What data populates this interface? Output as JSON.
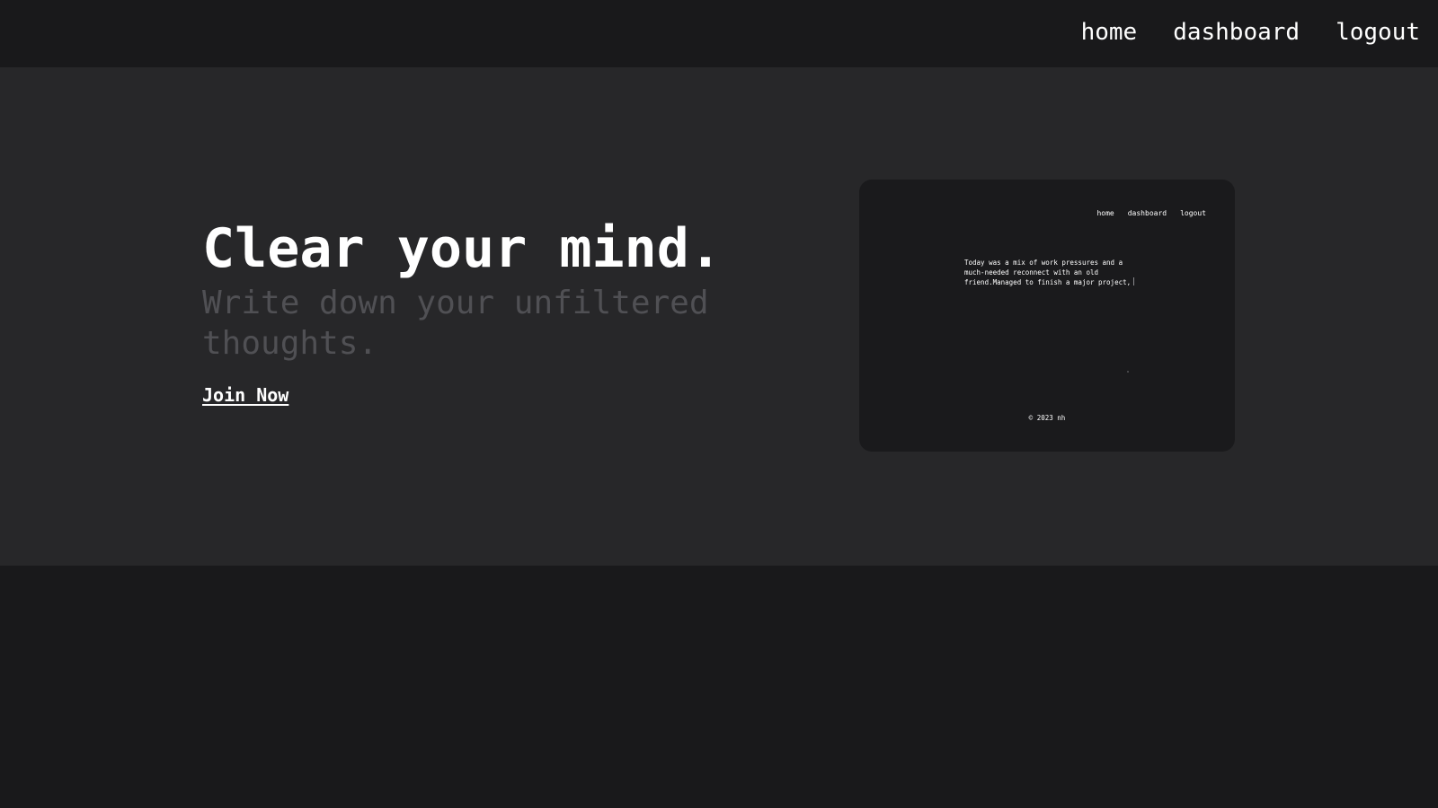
{
  "nav": {
    "items": [
      {
        "label": "home"
      },
      {
        "label": "dashboard"
      },
      {
        "label": "logout"
      }
    ]
  },
  "hero": {
    "headline": "Clear your mind.",
    "subheadline": "Write down your unfiltered thoughts.",
    "cta_label": "Join Now"
  },
  "preview": {
    "nav": {
      "items": [
        {
          "label": "home"
        },
        {
          "label": "dashboard"
        },
        {
          "label": "logout"
        }
      ]
    },
    "entry_lines": [
      "Today was a mix of work pressures and a",
      "much-needed reconnect with an old",
      "friend.Managed to finish a major project,"
    ],
    "footer": "© 2023 nh"
  },
  "colors": {
    "page_background": "#19191b",
    "hero_background": "#272729",
    "subheadline_text": "#505054",
    "primary_text": "#ffffff"
  }
}
